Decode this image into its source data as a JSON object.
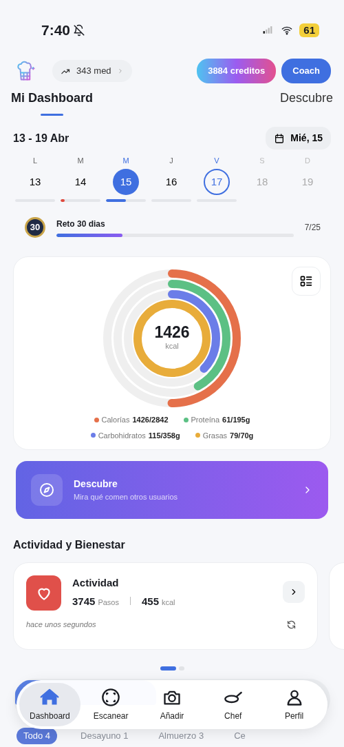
{
  "status_bar": {
    "time": "7:40",
    "battery": "61"
  },
  "header": {
    "streak": "343 med",
    "credits": "3884 creditos",
    "coach": "Coach"
  },
  "tabs": [
    {
      "label": "Mi Dashboard",
      "selected": true
    },
    {
      "label": "Descubre",
      "selected": false
    }
  ],
  "week": {
    "range": "13 - 19 Abr",
    "date_button": "Mié, 15",
    "days": [
      {
        "letter": "L",
        "number": "13",
        "selected": false,
        "today": false,
        "disabled": false
      },
      {
        "letter": "M",
        "number": "14",
        "selected": false,
        "today": false,
        "disabled": false,
        "level": 0.1,
        "color": "#e04b3f"
      },
      {
        "letter": "M",
        "number": "15",
        "selected": true,
        "today": false,
        "disabled": false,
        "level": 0.5,
        "color": "#3f6fe0"
      },
      {
        "letter": "J",
        "number": "16",
        "selected": false,
        "today": false,
        "disabled": false
      },
      {
        "letter": "V",
        "number": "17",
        "selected": false,
        "today": true,
        "disabled": false
      },
      {
        "letter": "S",
        "number": "18",
        "selected": false,
        "today": false,
        "disabled": true
      },
      {
        "letter": "D",
        "number": "19",
        "selected": false,
        "today": false,
        "disabled": true
      }
    ]
  },
  "challenge": {
    "badge": "30",
    "title": "Reto 30 dias",
    "count": "7/25",
    "level": 0.28
  },
  "nutrition": {
    "total": "1426",
    "unit": "kcal",
    "rings": [
      {
        "label": "Calorías",
        "value": "1426/2842",
        "color": "#e5704a",
        "level": 0.5
      },
      {
        "label": "Proteína",
        "value": "61/195g",
        "color": "#5cc084",
        "level": 0.42
      },
      {
        "label": "Carbohidratos",
        "value": "115/358g",
        "color": "#6b7de8",
        "level": 0.37
      },
      {
        "label": "Grasas",
        "value": "79/70g",
        "color": "#e8ac3a",
        "level": 1
      }
    ]
  },
  "discover_banner": {
    "title": "Descubre",
    "subtitle": "Mira qué comen otros usuarios"
  },
  "section_title": "Actividad y Bienestar",
  "activity": {
    "title": "Actividad",
    "steps": "3745",
    "steps_unit": "Pasos",
    "kcal": "455",
    "kcal_unit": "kcal",
    "updated": "hace unos segundos"
  },
  "pager": [
    {
      "selected": true
    },
    {
      "selected": false
    }
  ],
  "meal_progress": {
    "level": 0.45
  },
  "meal_filters": [
    {
      "label": "Todo",
      "count": "4",
      "selected": true
    },
    {
      "label": "Desayuno",
      "count": "1",
      "selected": false
    },
    {
      "label": "Almuerzo",
      "count": "3",
      "selected": false
    },
    {
      "label": "Ce",
      "selected": false
    }
  ],
  "bottom_nav": [
    {
      "label": "Dashboard",
      "selected": true
    },
    {
      "label": "Escanear",
      "selected": false
    },
    {
      "label": "Añadir",
      "selected": false
    },
    {
      "label": "Chef",
      "selected": false
    },
    {
      "label": "Perfil",
      "selected": false
    }
  ]
}
